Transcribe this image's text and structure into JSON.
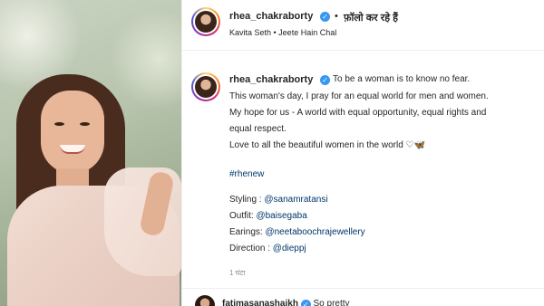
{
  "header": {
    "username": "rhea_chakraborty",
    "separator": "•",
    "follow_label": "फ़ॉलो कर रहे हैं",
    "song": "Kavita Seth • Jeete Hain Chal"
  },
  "caption": {
    "username": "rhea_chakraborty",
    "first_line": "To be a woman is to know no fear.",
    "lines": [
      "This woman's day, I pray for an equal world for men and women.",
      "My hope for us - A world with equal opportunity, equal rights and",
      "equal respect.",
      "Love to all the beautiful women in the world ♡🦋"
    ],
    "hashtag": "#rhenew",
    "credits": [
      {
        "label": "Styling : ",
        "handle": "@sanamratansi"
      },
      {
        "label": "Outfit: ",
        "handle": "@baisegaba"
      },
      {
        "label": "Earings: ",
        "handle": "@neetaboochrajewellery"
      },
      {
        "label": "Direction : ",
        "handle": "@dieppj"
      }
    ],
    "time": "1 घंटा"
  },
  "comment": {
    "username": "fatimasanashaikh",
    "text": "So pretty"
  },
  "colors": {
    "verified": "#3897f0",
    "link": "#00376b",
    "muted": "#8e8e8e"
  }
}
